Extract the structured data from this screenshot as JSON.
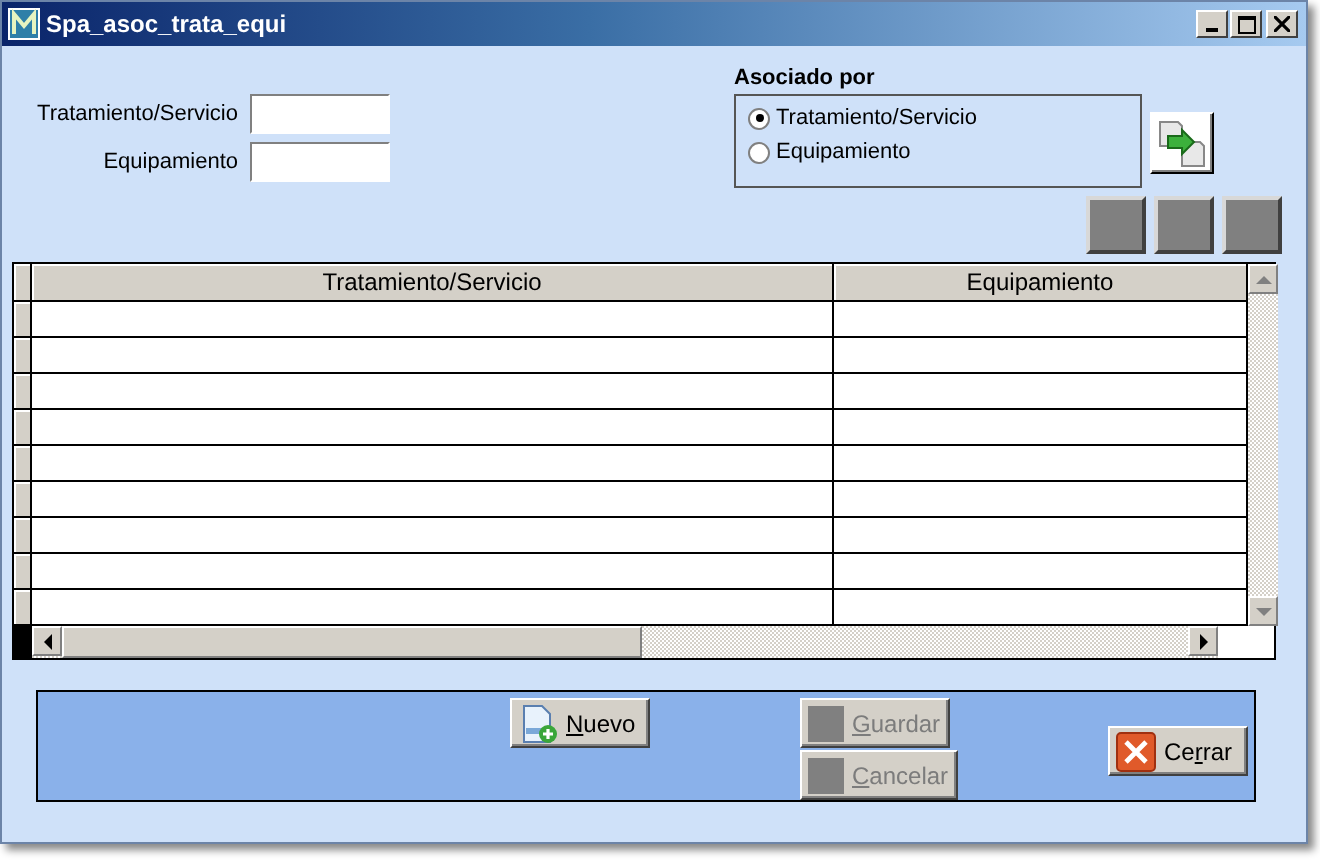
{
  "window": {
    "title": "Spa_asoc_trata_equi",
    "controls": [
      {
        "kind": "minimize"
      },
      {
        "kind": "maximize"
      },
      {
        "kind": "close"
      }
    ]
  },
  "filters": [
    {
      "label": "Tratamiento/Servicio"
    },
    {
      "label": "Equipamiento"
    }
  ],
  "association": {
    "title": "Asociado por",
    "options": [
      {
        "label": "Tratamiento/Servicio",
        "selected": true
      },
      {
        "label": "Equipamiento",
        "selected": false
      }
    ]
  },
  "table": {
    "columns": [
      "Tratamiento/Servicio",
      "Equipamiento"
    ]
  },
  "actions": [
    {
      "kind": "new",
      "key": "N",
      "post": "uevo",
      "disabled": false
    },
    {
      "kind": "save",
      "key": "G",
      "post": "uardar",
      "disabled": true
    },
    {
      "kind": "cancel",
      "key": "C",
      "post": "ancelar",
      "disabled": true
    },
    {
      "kind": "close",
      "pre": "Ce",
      "key": "r",
      "post": "rar",
      "disabled": false
    }
  ]
}
